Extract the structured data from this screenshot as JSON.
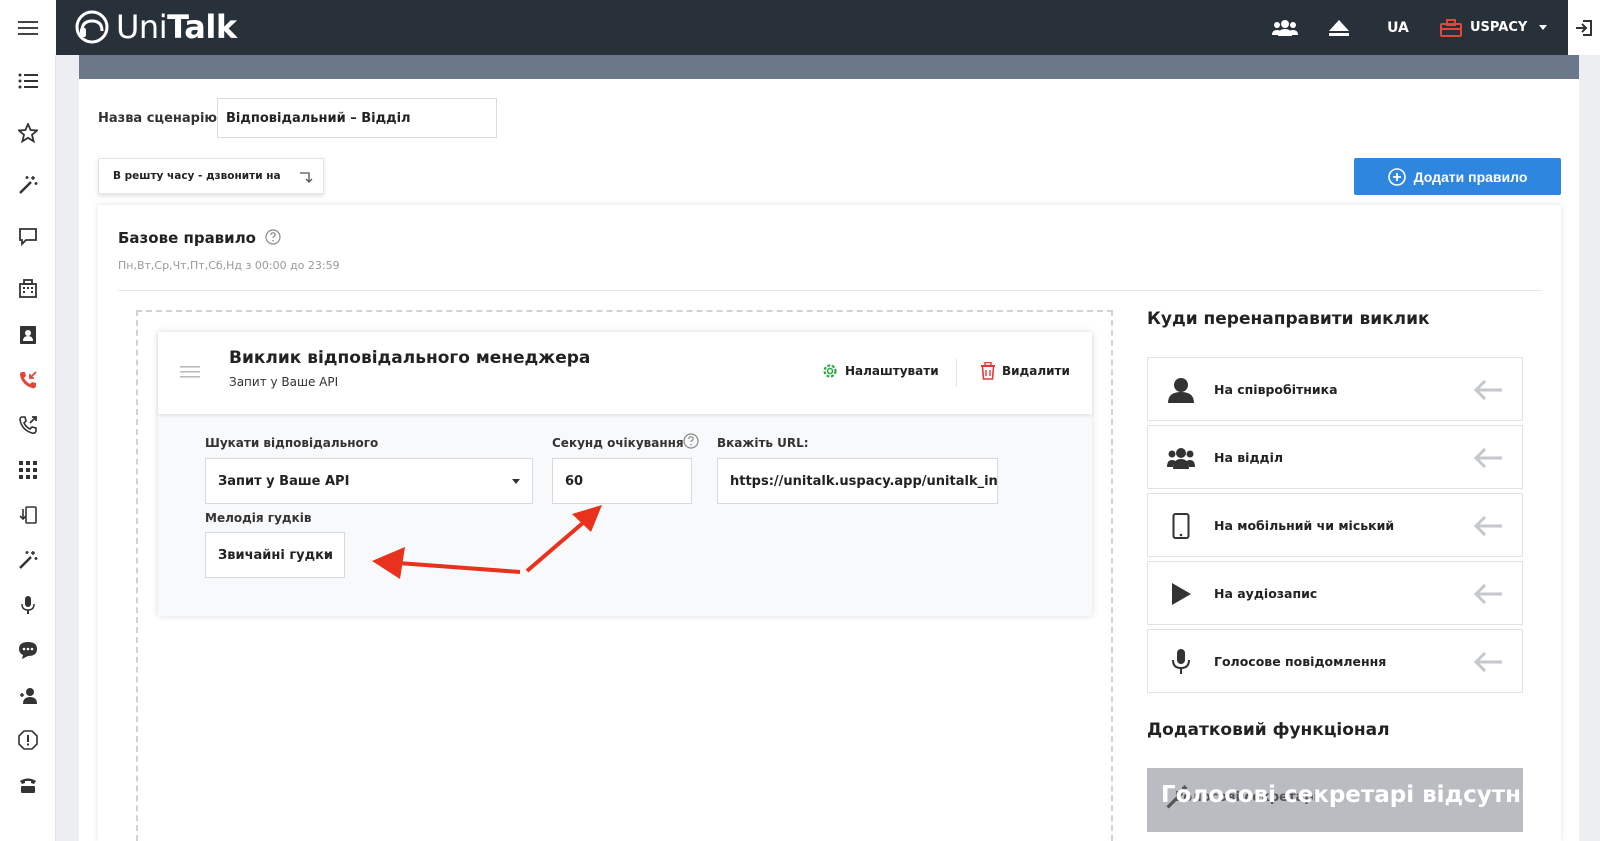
{
  "header": {
    "logo_text_a": "Uni",
    "logo_text_b": "Talk",
    "lang": "UA",
    "company": "USPACY"
  },
  "scenario": {
    "label": "Назва сценарію",
    "name_value": "Відповідальний – Відділ"
  },
  "time_tab": {
    "label": "В решту часу - дзвонити на"
  },
  "add_rule_label": "Додати правило",
  "rule": {
    "title": "Базове правило",
    "schedule": "Пн,Вт,Ср,Чт,Пт,Сб,Нд з 00:00 до 23:59"
  },
  "step": {
    "title": "Виклик відповідального менеджера",
    "subtitle": "Запит у Ваше API",
    "configure_label": "Налаштувати",
    "delete_label": "Видалити",
    "search_label": "Шукати відповідального",
    "search_value": "Запит у Ваше API",
    "wait_label": "Секунд очікування",
    "wait_value": "60",
    "url_label": "Вкажіть URL:",
    "url_value": "https://unitalk.uspacy.app/unitalk_inte",
    "melody_label": "Мелодія гудків",
    "melody_value": "Звичайні гудки"
  },
  "redirect": {
    "title": "Куди перенаправити виклик",
    "items": [
      {
        "label": "На співробітника",
        "icon": "person-icon"
      },
      {
        "label": "На відділ",
        "icon": "group-icon"
      },
      {
        "label": "На мобільний чи міський",
        "icon": "mobile-phone-icon"
      },
      {
        "label": "На аудіозапис",
        "icon": "play-icon"
      },
      {
        "label": "Голосове повідомлення",
        "icon": "microphone-icon"
      }
    ]
  },
  "extra": {
    "title": "Додатковий функціонал",
    "under_label": "Голосові секретарі",
    "overlay_text": "Голосові секретарі відсутні"
  },
  "colors": {
    "topbar": "#283039",
    "accent_blue": "#2e86de",
    "configure_green": "#2ea84a",
    "delete_red": "#e03a3a",
    "annotation_arrow": "#e8321e"
  }
}
